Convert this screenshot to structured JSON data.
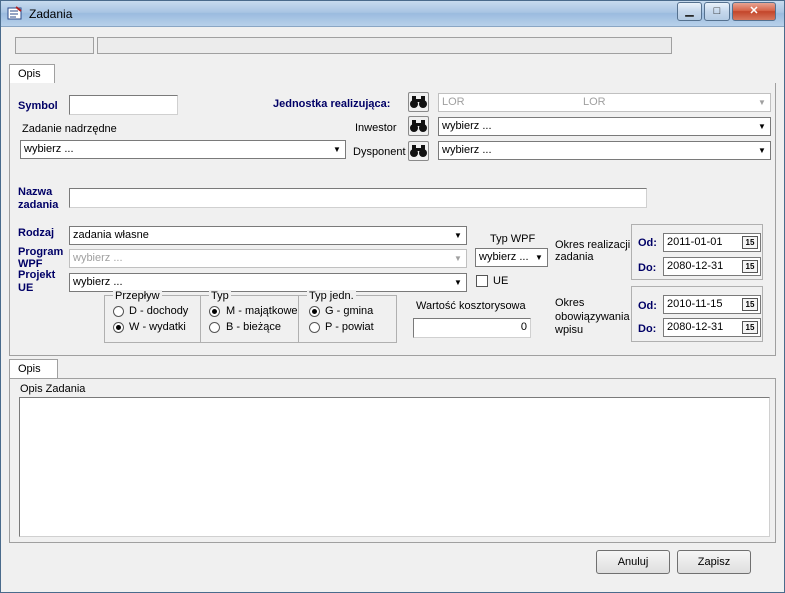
{
  "window": {
    "title": "Zadania",
    "minimize": "▁",
    "maximize": "□",
    "close": "✕"
  },
  "tabs_top": [
    "Opis"
  ],
  "form": {
    "symbol_label": "Symbol",
    "symbol_value": "",
    "jednostka_label": "Jednostka realizująca:",
    "jednostka_value_a": "LOR",
    "jednostka_value_b": "LOR",
    "zadanie_nadrzedne_label": "Zadanie nadrzędne",
    "zadanie_nadrzedne_value": "wybierz ...",
    "inwestor_label": "Inwestor",
    "inwestor_value": "wybierz ...",
    "dysponent_label": "Dysponent",
    "dysponent_value": "wybierz ...",
    "nazwa_label_1": "Nazwa",
    "nazwa_label_2": "zadania",
    "nazwa_value": "",
    "rodzaj_label": "Rodzaj",
    "rodzaj_value": "zadania własne",
    "program_label_1": "Program",
    "program_label_2": "WPF",
    "program_value": "wybierz ...",
    "projekt_label_1": "Projekt",
    "projekt_label_2": "UE",
    "projekt_value": "wybierz ...",
    "typ_wpf_label": "Typ WPF",
    "typ_wpf_value": "wybierz ...",
    "ue_label": "UE",
    "okres_realizacji_label": [
      "Okres realizacji",
      "zadania"
    ],
    "od_label": "Od:",
    "do_label": "Do:",
    "realizacji_od": "2011-01-01",
    "realizacji_do": "2080-12-31",
    "okres_obowiazywania_label": [
      "Okres",
      "obowiązywania",
      "wpisu"
    ],
    "obowiazywania_od": "2010-11-15",
    "obowiazywania_do": "2080-12-31",
    "calendar_glyph": "15",
    "przeplyw": {
      "title": "Przepływ",
      "options": [
        "D - dochody",
        "W - wydatki"
      ],
      "selected": 1
    },
    "typ": {
      "title": "Typ",
      "options": [
        "M - majątkowe",
        "B - bieżące"
      ],
      "selected": 0
    },
    "typ_jedn": {
      "title": "Typ jedn.",
      "options": [
        "G - gmina",
        "P - powiat"
      ],
      "selected": 0
    },
    "wartosc_label": "Wartość kosztorysowa",
    "wartosc_value": "0"
  },
  "tabs_bottom": [
    "Opis"
  ],
  "opis": {
    "label": "Opis Zadania",
    "value": ""
  },
  "buttons": {
    "cancel": "Anuluj",
    "save": "Zapisz"
  },
  "colors": {
    "label_blue": "#000066",
    "titlebar": "#a9c5e3"
  }
}
